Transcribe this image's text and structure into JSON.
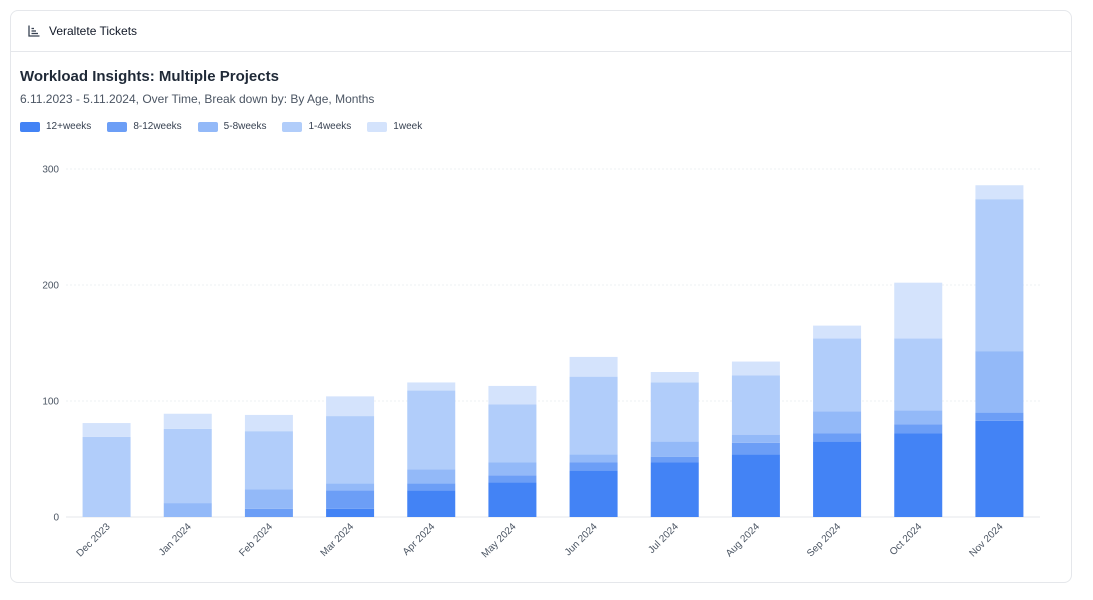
{
  "card": {
    "header_title": "Veraltete Tickets",
    "header_icon": "bar-chart-icon"
  },
  "chart_data": {
    "type": "bar",
    "stacked": true,
    "title": "Workload Insights: Multiple Projects",
    "subtitle": "6.11.2023 - 5.11.2024, Over Time, Break down by: By Age, Months",
    "xlabel": "",
    "ylabel": "",
    "ylim": [
      0,
      300
    ],
    "yticks": [
      0,
      100,
      200,
      300
    ],
    "grid": true,
    "legend_position": "top-left",
    "categories": [
      "Dec 2023",
      "Jan 2024",
      "Feb 2024",
      "Mar 2024",
      "Apr 2024",
      "May 2024",
      "Jun 2024",
      "Jul 2024",
      "Aug 2024",
      "Sep 2024",
      "Oct 2024",
      "Nov 2024"
    ],
    "series": [
      {
        "name": "12+weeks",
        "color": "#4383f5",
        "values": [
          0,
          0,
          0,
          7,
          23,
          30,
          40,
          47,
          54,
          65,
          72,
          83
        ]
      },
      {
        "name": "8-12weeks",
        "color": "#6c9ef6",
        "values": [
          0,
          0,
          7,
          16,
          6,
          6,
          7,
          5,
          10,
          7,
          8,
          7
        ]
      },
      {
        "name": "5-8weeks",
        "color": "#93b9f8",
        "values": [
          0,
          12,
          17,
          6,
          12,
          11,
          7,
          13,
          7,
          19,
          12,
          53
        ]
      },
      {
        "name": "1-4weeks",
        "color": "#b1cdfa",
        "values": [
          69,
          64,
          50,
          58,
          68,
          50,
          67,
          51,
          51,
          63,
          62,
          131
        ]
      },
      {
        "name": "1week",
        "color": "#d4e3fc",
        "values": [
          12,
          13,
          14,
          17,
          7,
          16,
          17,
          9,
          12,
          11,
          48,
          12
        ]
      }
    ]
  }
}
